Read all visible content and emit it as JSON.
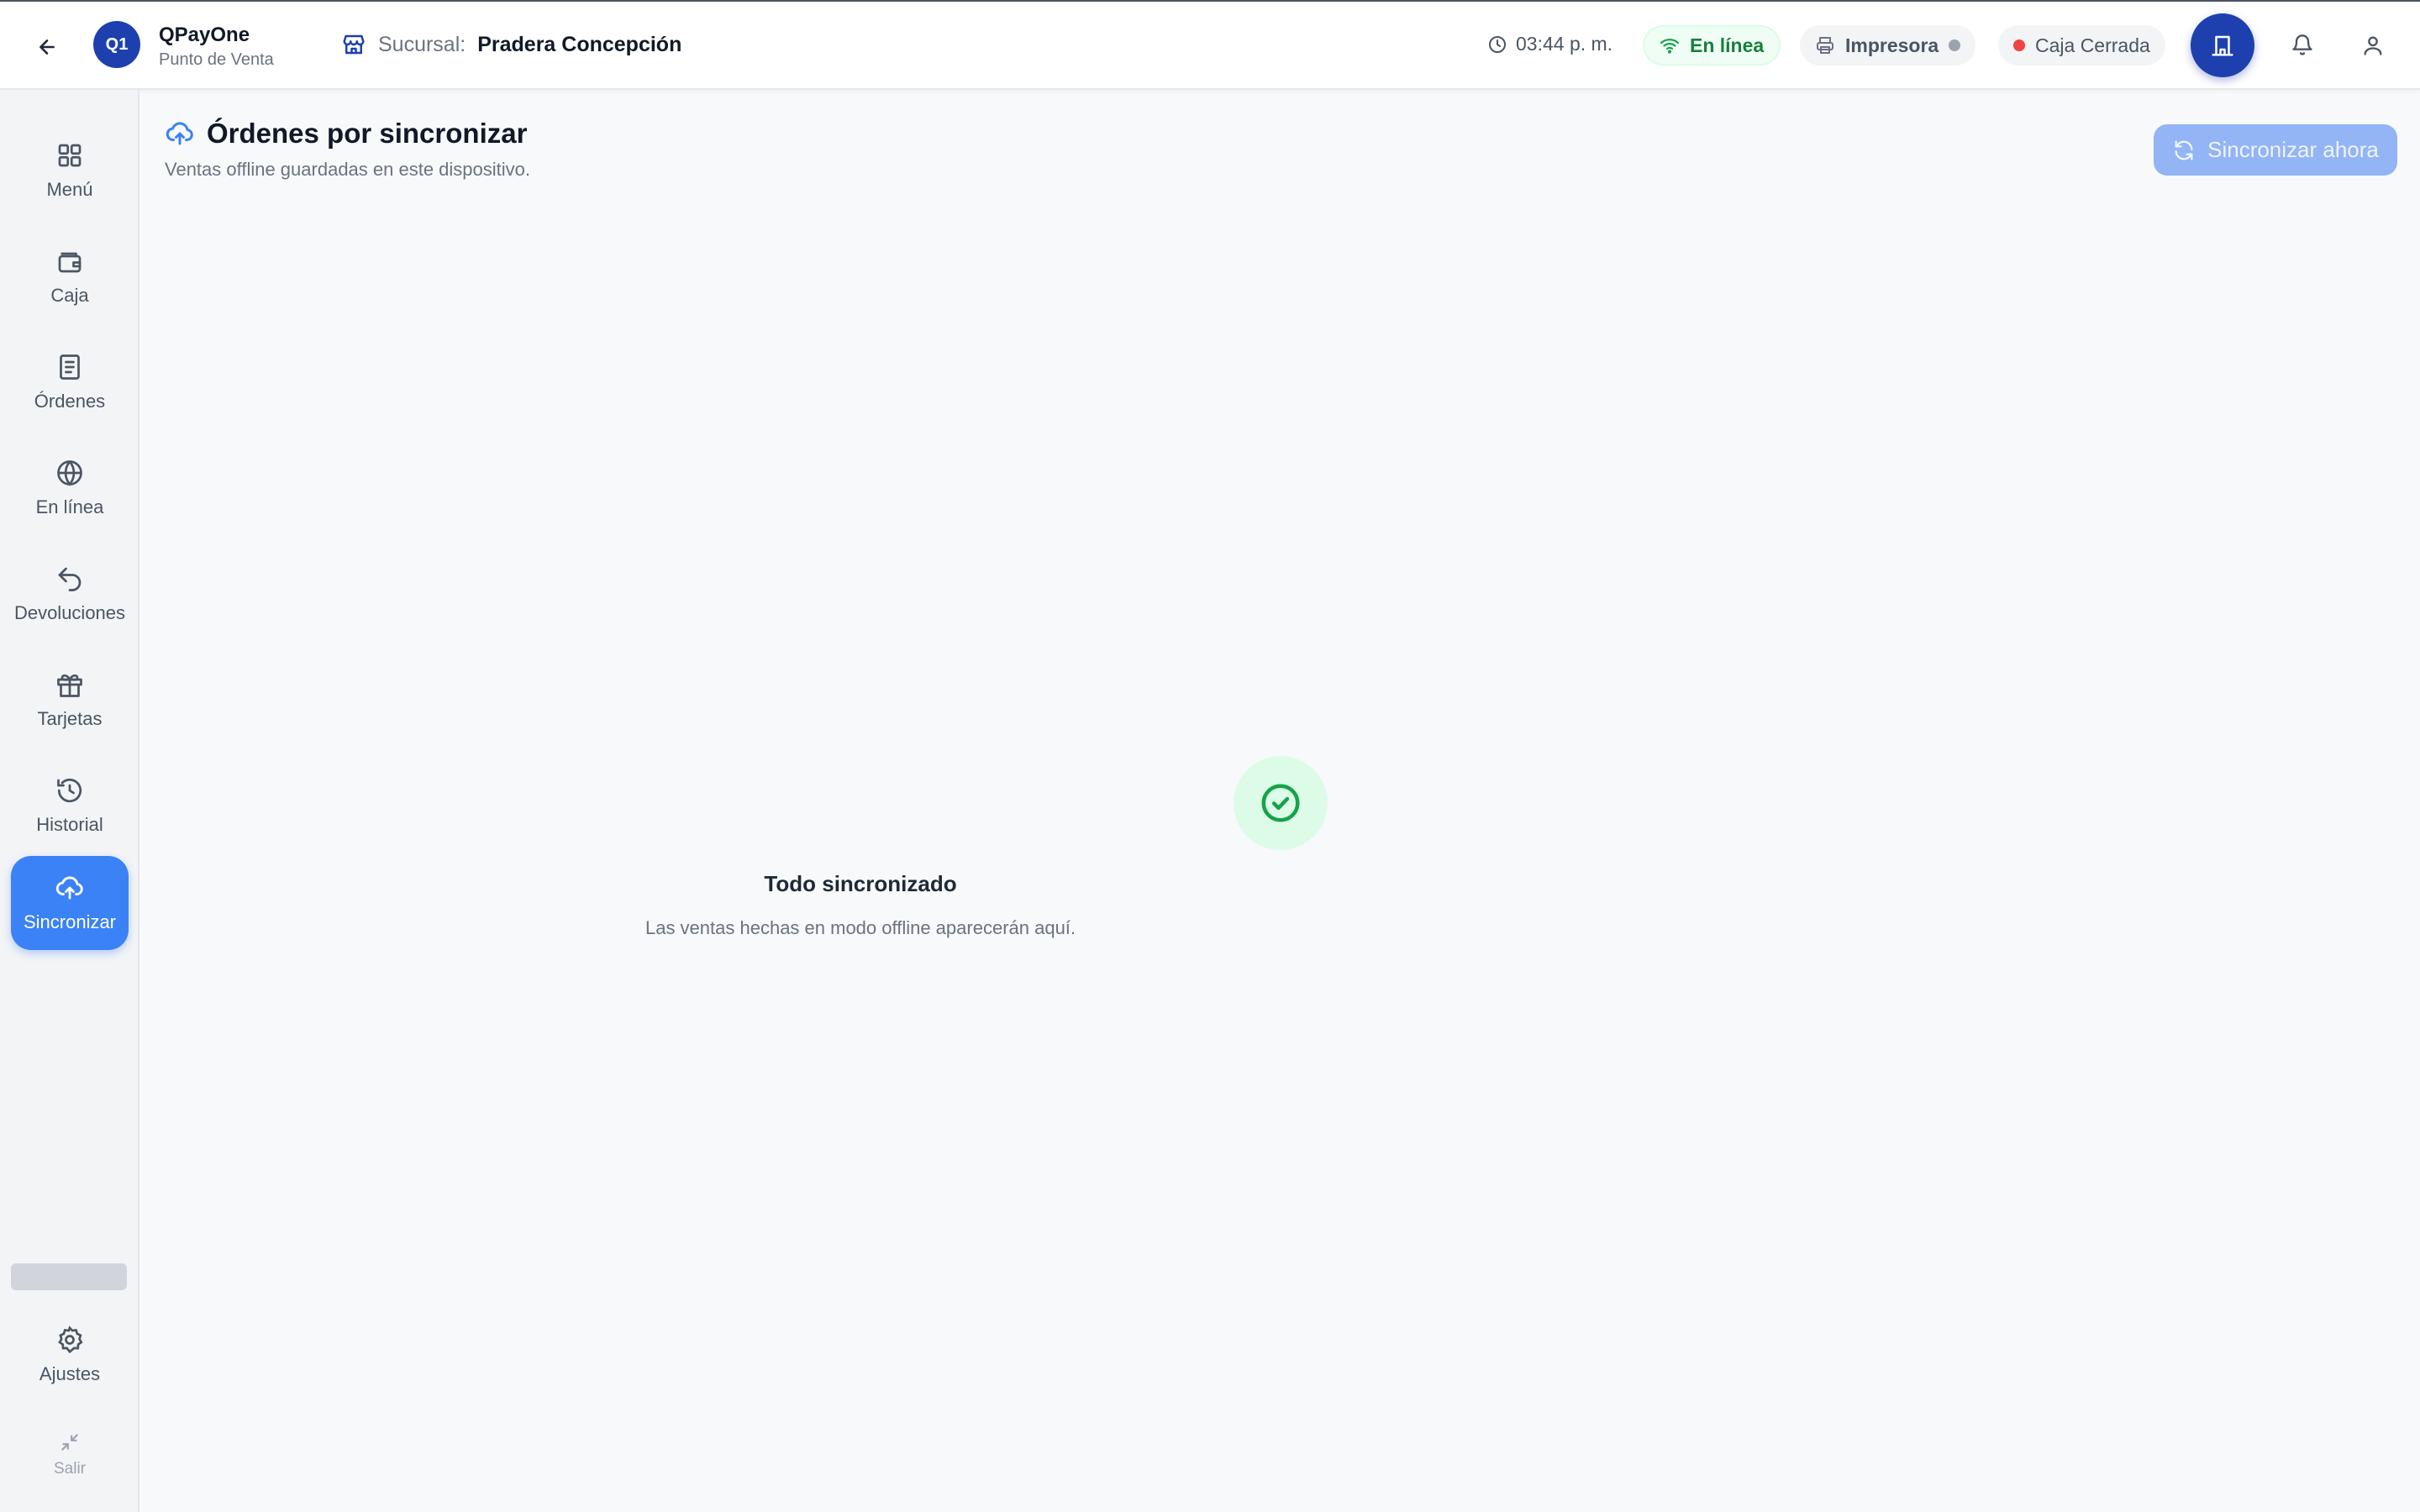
{
  "header": {
    "brand_initials": "Q1",
    "brand_name": "QPayOne",
    "brand_sub": "Punto de Venta",
    "branch_label": "Sucursal:",
    "branch_name": "Pradera Concepción",
    "time": "03:44 p. m.",
    "online_label": "En línea",
    "printer_label": "Impresora",
    "cash_status": "Caja Cerrada"
  },
  "sidebar": {
    "items": [
      {
        "label": "Menú",
        "icon": "grid-icon"
      },
      {
        "label": "Caja",
        "icon": "wallet-icon"
      },
      {
        "label": "Órdenes",
        "icon": "receipt-icon"
      },
      {
        "label": "En línea",
        "icon": "globe-icon"
      },
      {
        "label": "Devoluciones",
        "icon": "undo-icon"
      },
      {
        "label": "Tarjetas",
        "icon": "gift-icon"
      },
      {
        "label": "Historial",
        "icon": "history-icon"
      },
      {
        "label": "Sincronizar",
        "icon": "cloud-upload-icon",
        "active": true
      }
    ],
    "settings_label": "Ajustes",
    "exit_label": "Salir"
  },
  "main": {
    "title": "Órdenes por sincronizar",
    "subtitle": "Ventas offline guardadas en este dispositivo.",
    "sync_button": "Sincronizar ahora",
    "empty_title": "Todo sincronizado",
    "empty_subtitle": "Las ventas hechas en modo offline aparecerán aquí."
  },
  "colors": {
    "primary": "#1e40af",
    "accent": "#3b82f6",
    "online_green": "#15803d",
    "caja_closed_red": "#ef4444",
    "printer_dot": "#9ca3af"
  }
}
